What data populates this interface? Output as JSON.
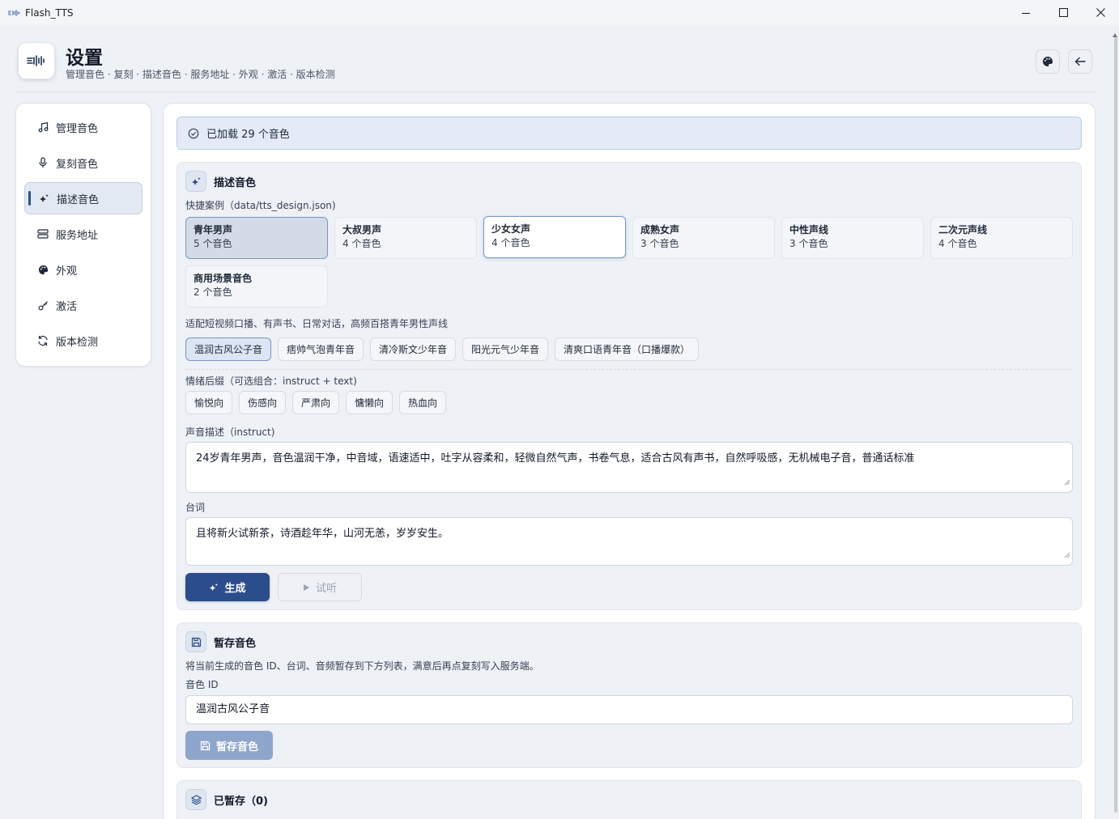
{
  "window": {
    "title": "Flash_TTS",
    "controls": [
      "minimize",
      "maximize",
      "close"
    ]
  },
  "header": {
    "title": "设置",
    "subtitle": "管理音色 · 复刻 · 描述音色 · 服务地址 · 外观 · 激活 · 版本检测",
    "actions": [
      "palette-icon",
      "back-arrow-icon"
    ]
  },
  "sidebar": {
    "items": [
      {
        "label": "管理音色",
        "icon": "music-note-icon"
      },
      {
        "label": "复刻音色",
        "icon": "microphone-icon"
      },
      {
        "label": "描述音色",
        "icon": "sparkles-icon",
        "active": true
      },
      {
        "label": "服务地址",
        "icon": "server-icon"
      },
      {
        "label": "外观",
        "icon": "palette-icon"
      },
      {
        "label": "激活",
        "icon": "key-icon"
      },
      {
        "label": "版本检测",
        "icon": "refresh-icon"
      }
    ]
  },
  "status": {
    "text": "已加载 29 个音色"
  },
  "design": {
    "title": "描述音色",
    "presets_label": "快捷案例（data/tts_design.json)",
    "presets": [
      {
        "name": "青年男声",
        "count": "5 个音色"
      },
      {
        "name": "大叔男声",
        "count": "4 个音色"
      },
      {
        "name": "少女女声",
        "count": "4 个音色"
      },
      {
        "name": "成熟女声",
        "count": "3 个音色"
      },
      {
        "name": "中性声线",
        "count": "3 个音色"
      },
      {
        "name": "二次元声线",
        "count": "4 个音色"
      },
      {
        "name": "商用场景音色",
        "count": "2 个音色"
      }
    ],
    "selected_preset": "青年男声",
    "preset_desc": "适配短视频口播、有声书、日常对话，高频百搭青年男性声线",
    "voices": [
      "温润古风公子音",
      "痞帅气泡青年音",
      "清冷斯文少年音",
      "阳光元气少年音",
      "清爽口语青年音（口播爆款）"
    ],
    "selected_voice": "温润古风公子音",
    "emotion_label": "情绪后缀（可选组合：instruct + text)",
    "emotions": [
      "愉悦向",
      "伤感向",
      "严肃向",
      "慵懒向",
      "热血向"
    ],
    "instruct_label": "声音描述（instruct)",
    "instruct_value": "24岁青年男声，音色温润干净，中音域，语速适中，吐字从容柔和，轻微自然气声，书卷气息，适合古风有声书，自然呼吸感，无机械电子音，普通话标准",
    "text_label": "台词",
    "text_value": "且将新火试新茶，诗酒趁年华，山河无恙，岁岁安生。",
    "generate_label": "生成",
    "preview_label": "试听"
  },
  "stash": {
    "title": "暂存音色",
    "desc": "将当前生成的音色 ID、台词、音频暂存到下方列表，满意后再点复刻写入服务端。",
    "id_label": "音色 ID",
    "id_value": "温润古风公子音",
    "button_label": "暂存音色"
  },
  "saved": {
    "title": "已暂存（0)"
  },
  "colors": {
    "accent": "#2b4d8c",
    "banner_bg": "#e3ebf7",
    "card_bg": "#eef1f6"
  }
}
